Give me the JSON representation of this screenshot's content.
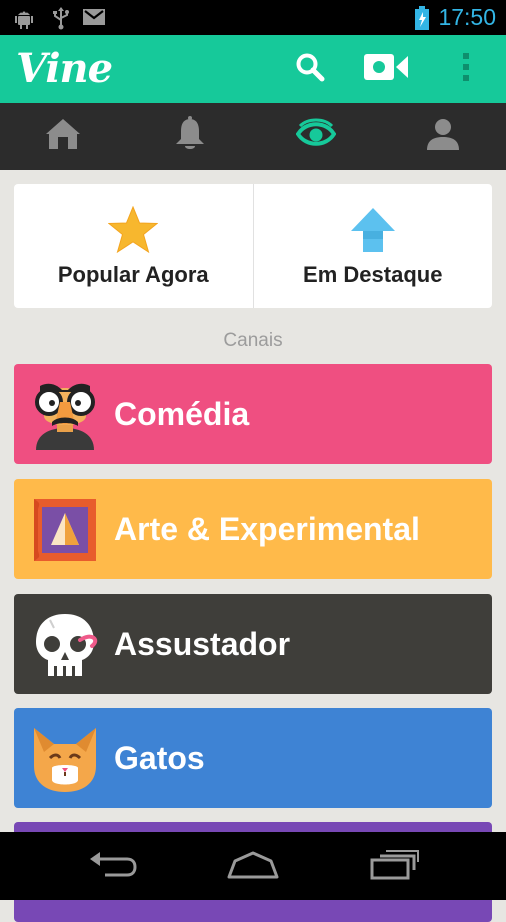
{
  "status_bar": {
    "time": "17:50",
    "icons": [
      "android-debug-icon",
      "usb-icon",
      "gmail-icon",
      "battery-charging-icon"
    ]
  },
  "app_bar": {
    "logo": "Vine",
    "actions": [
      "search-icon",
      "video-camera-icon",
      "overflow-menu-icon"
    ],
    "color": "#16c99a"
  },
  "nav_tabs": [
    {
      "icon": "home-icon",
      "active": false
    },
    {
      "icon": "bell-icon",
      "active": false
    },
    {
      "icon": "eye-icon",
      "active": true
    },
    {
      "icon": "profile-icon",
      "active": false
    }
  ],
  "featured": {
    "popular": "Popular Agora",
    "trending": "Em Destaque"
  },
  "channels_label": "Canais",
  "channels": [
    {
      "label": "Comédia",
      "color": "#ef4f81",
      "icon": "disguise-glasses-icon"
    },
    {
      "label": "Arte & Experimental",
      "color": "#ffba4a",
      "icon": "picture-frame-icon"
    },
    {
      "label": "Assustador",
      "color": "#3f3e3a",
      "icon": "skull-icon"
    },
    {
      "label": "Gatos",
      "color": "#3e83d4",
      "icon": "cat-icon"
    }
  ],
  "next_channel_color": "#7848b5",
  "nav_bar": [
    "back-icon",
    "home-button-icon",
    "recent-apps-icon"
  ]
}
